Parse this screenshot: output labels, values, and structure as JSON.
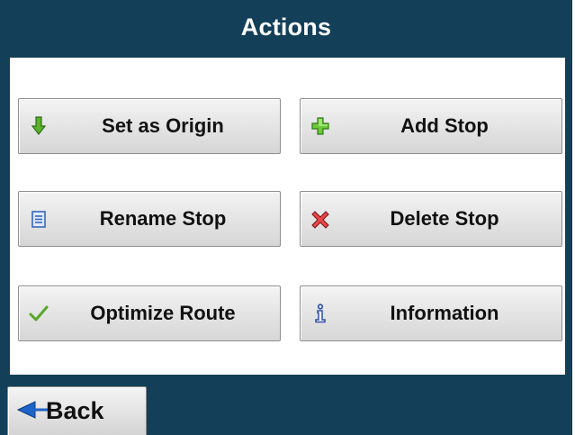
{
  "header": {
    "title": "Actions"
  },
  "actions": [
    {
      "id": "set-origin",
      "label": "Set as Origin",
      "icon": "arrow-down-icon",
      "icon_color": "#4a9a1c"
    },
    {
      "id": "add-stop",
      "label": "Add Stop",
      "icon": "plus-icon",
      "icon_color": "#4fb21f"
    },
    {
      "id": "rename-stop",
      "label": "Rename Stop",
      "icon": "document-icon",
      "icon_color": "#2d5fb5"
    },
    {
      "id": "delete-stop",
      "label": "Delete Stop",
      "icon": "x-icon",
      "icon_color": "#d8393a"
    },
    {
      "id": "optimize-route",
      "label": "Optimize Route",
      "icon": "checkmark-icon",
      "icon_color": "#5aa72b"
    },
    {
      "id": "information",
      "label": "Information",
      "icon": "info-icon",
      "icon_color": "#2f4fa8"
    }
  ],
  "footer": {
    "back_label": "Back",
    "back_icon": "arrow-left-icon",
    "back_icon_color": "#1e63c8"
  },
  "colors": {
    "frame": "#133f58",
    "panel": "#ffffff",
    "button_text": "#111111"
  }
}
